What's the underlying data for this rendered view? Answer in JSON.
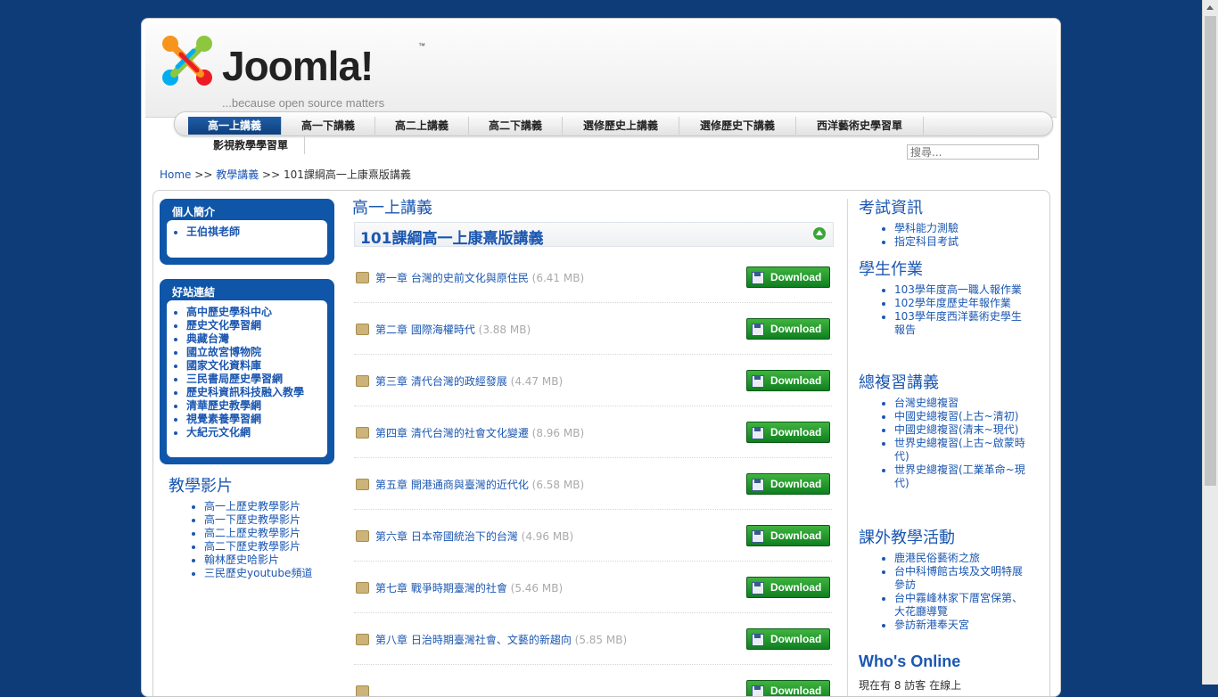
{
  "logo": {
    "word": "Joomla!",
    "tm": "™",
    "tagline": "...because open source matters"
  },
  "menu": {
    "items": [
      "高一上講義",
      "高一下講義",
      "高二上講義",
      "高二下講義",
      "選修歷史上講義",
      "選修歷史下講義",
      "西洋藝術史學習單"
    ],
    "row2": "影視教學學習單"
  },
  "search": {
    "placeholder": "搜尋..."
  },
  "breadcrumb": {
    "home": "Home",
    "sep1": ">>",
    "cat": "教學講義",
    "sep2": ">>",
    "current": "101課綱高一上康熹版講義"
  },
  "left": {
    "profile": {
      "title": "個人簡介",
      "items": [
        "王伯祺老師"
      ]
    },
    "links": {
      "title": "好站連結",
      "items": [
        "高中歷史學科中心",
        "歷史文化學習網",
        "典藏台灣",
        "國立故宮博物院",
        "國家文化資料庫",
        "三民書局歷史學習網",
        "歷史科資訊科技融入教學",
        "清華歷史教學網",
        "視覺素養學習網",
        "大紀元文化網"
      ]
    },
    "videos": {
      "title": "教學影片",
      "items": [
        "高一上歷史教學影片",
        "高一下歷史教學影片",
        "高二上歷史教學影片",
        "高二下歷史教學影片",
        "翰林歷史哈影片",
        "三民歷史youtube頻道"
      ]
    }
  },
  "main": {
    "title": "高一上講義",
    "category": "101課綱高一上康熹版講義",
    "download_label": "Download",
    "docs": [
      {
        "name": "第一章 台灣的史前文化與原住民",
        "size": "(6.41 MB)"
      },
      {
        "name": "第二章 國際海權時代",
        "size": "(3.88 MB)"
      },
      {
        "name": "第三章 清代台灣的政經發展",
        "size": "(4.47 MB)"
      },
      {
        "name": "第四章 清代台灣的社會文化變遷",
        "size": "(8.96 MB)"
      },
      {
        "name": "第五章 開港通商與臺灣的近代化",
        "size": "(6.58 MB)"
      },
      {
        "name": "第六章 日本帝國統治下的台灣",
        "size": "(4.96 MB)"
      },
      {
        "name": "第七章 戰爭時期臺灣的社會",
        "size": "(5.46 MB)"
      },
      {
        "name": "第八章 日治時期臺灣社會、文藝的新趨向",
        "size": "(5.85 MB)"
      }
    ]
  },
  "right": {
    "exam": {
      "title": "考試資訊",
      "items": [
        "學科能力測驗",
        "指定科目考試"
      ]
    },
    "homework": {
      "title": "學生作業",
      "items": [
        "103學年度高一職人報作業",
        "102學年度歷史年報作業",
        "103學年度西洋藝術史學生報告"
      ]
    },
    "review": {
      "title": "總複習講義",
      "items": [
        "台灣史總複習",
        "中國史總複習(上古~清初)",
        "中國史總複習(清末~現代)",
        "世界史總複習(上古~啟蒙時代)",
        "世界史總複習(工業革命~現代)"
      ]
    },
    "activities": {
      "title": "課外教學活動",
      "items": [
        "鹿港民俗藝術之旅",
        "台中科博館古埃及文明特展參訪",
        "台中霧峰林家下厝宮保第、大花廳導覽",
        "參訪新港奉天宮"
      ]
    },
    "online": {
      "title": "Who's Online",
      "text": "現在有 8 訪客 在線上"
    }
  },
  "colors": {
    "background": "#0d3c78",
    "accent": "#1b57b1",
    "module": "#0f56a8",
    "download": "#1f9a2a"
  }
}
